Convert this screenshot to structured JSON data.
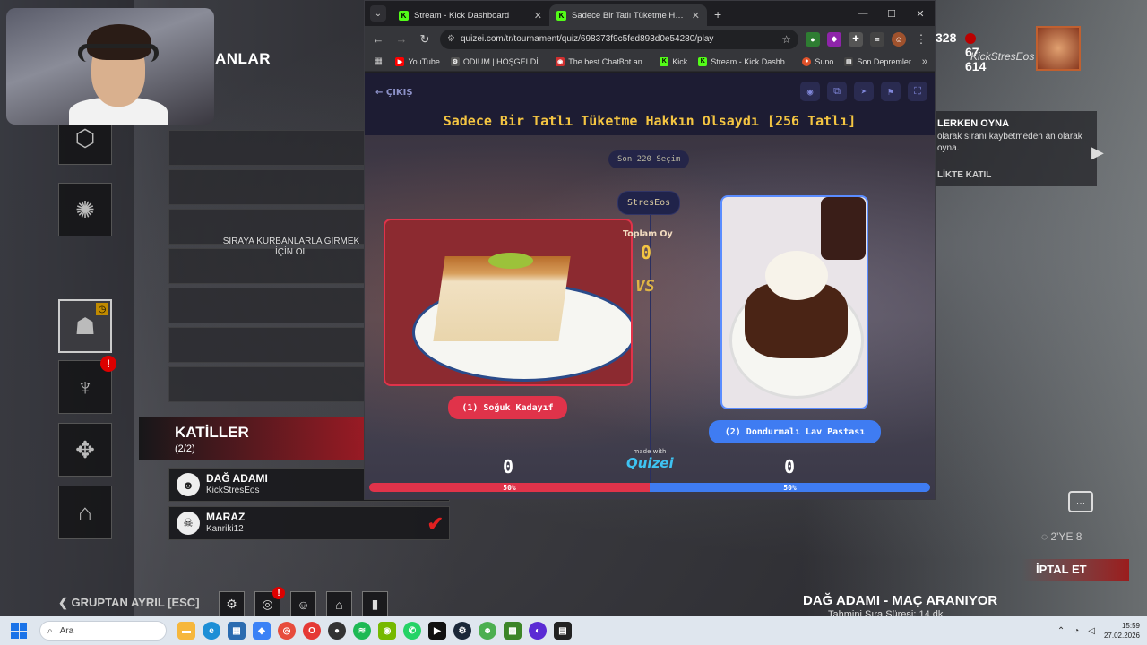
{
  "game": {
    "lobby_title": "ANLAR",
    "lobby_message": "SIRAYA KURBANLARLA GİRMEK İÇİN OL",
    "killers_title": "KATİLLER",
    "killers_count": "(2/2)",
    "killers": [
      {
        "name": "DAĞ ADAMI",
        "user": "KickStresEos",
        "selected": false
      },
      {
        "name": "MARAZ",
        "user": "Kanriki12",
        "selected": true
      }
    ],
    "leave_group": "GRUPTAN AYRIL [ESC]",
    "currency_partial": "328",
    "bloodpoints": "67 614",
    "player_name": "KickStresEos",
    "info_title": "LERKEN OYNA",
    "info_desc": "olarak sıranı kaybetmeden an olarak oyna.",
    "info_link": "LİKTE KATIL",
    "party_count": "2'YE 8",
    "cancel_label": "İPTAL ET",
    "status": "DAĞ ADAMI - MAÇ ARANIYOR",
    "status_sub": "Tahmini Sıra Süresi: 14 dk"
  },
  "browser": {
    "tabs": [
      {
        "label": "Stream - Kick Dashboard",
        "active": false,
        "icon_color": "#53fc18",
        "icon_text": "K"
      },
      {
        "label": "Sadece Bir Tatlı Tüketme Hakkın",
        "active": true,
        "icon_color": "#53fc18",
        "icon_text": "K"
      }
    ],
    "url": "quizei.com/tr/tournament/quiz/698373f9c5fed893d0e54280/play",
    "bookmarks": [
      {
        "label": "YouTube",
        "color": "#ff0000"
      },
      {
        "label": "ODIUM | HOŞGELDİ...",
        "color": "#555"
      },
      {
        "label": "The best ChatBot an...",
        "color": "#d03030"
      },
      {
        "label": "Kick",
        "color": "#53fc18"
      },
      {
        "label": "Stream - Kick Dashb...",
        "color": "#53fc18"
      },
      {
        "label": "Suno",
        "color": "#e0522a"
      },
      {
        "label": "Son Depremler",
        "color": "#444"
      }
    ]
  },
  "quiz": {
    "exit_label": "ÇIKIŞ",
    "title": "Sadece Bir Tatlı Tüketme Hakkın Olsaydı [256 Tatlı]",
    "selection_pill": "Son 220 Seçim",
    "user_pill": "StresEos",
    "total_label": "Toplam Oy",
    "total_votes": "0",
    "vs": "VS",
    "left_option": "(1) Soğuk Kadayıf",
    "right_option": "(2) Dondurmalı Lav Pastası",
    "made_with": "made with",
    "brand": "Quizei",
    "left_score": "0",
    "right_score": "0",
    "left_pct": "50%",
    "right_pct": "50%"
  },
  "taskbar": {
    "search_placeholder": "Ara",
    "time": "15:59",
    "date": "27.02.2026"
  }
}
